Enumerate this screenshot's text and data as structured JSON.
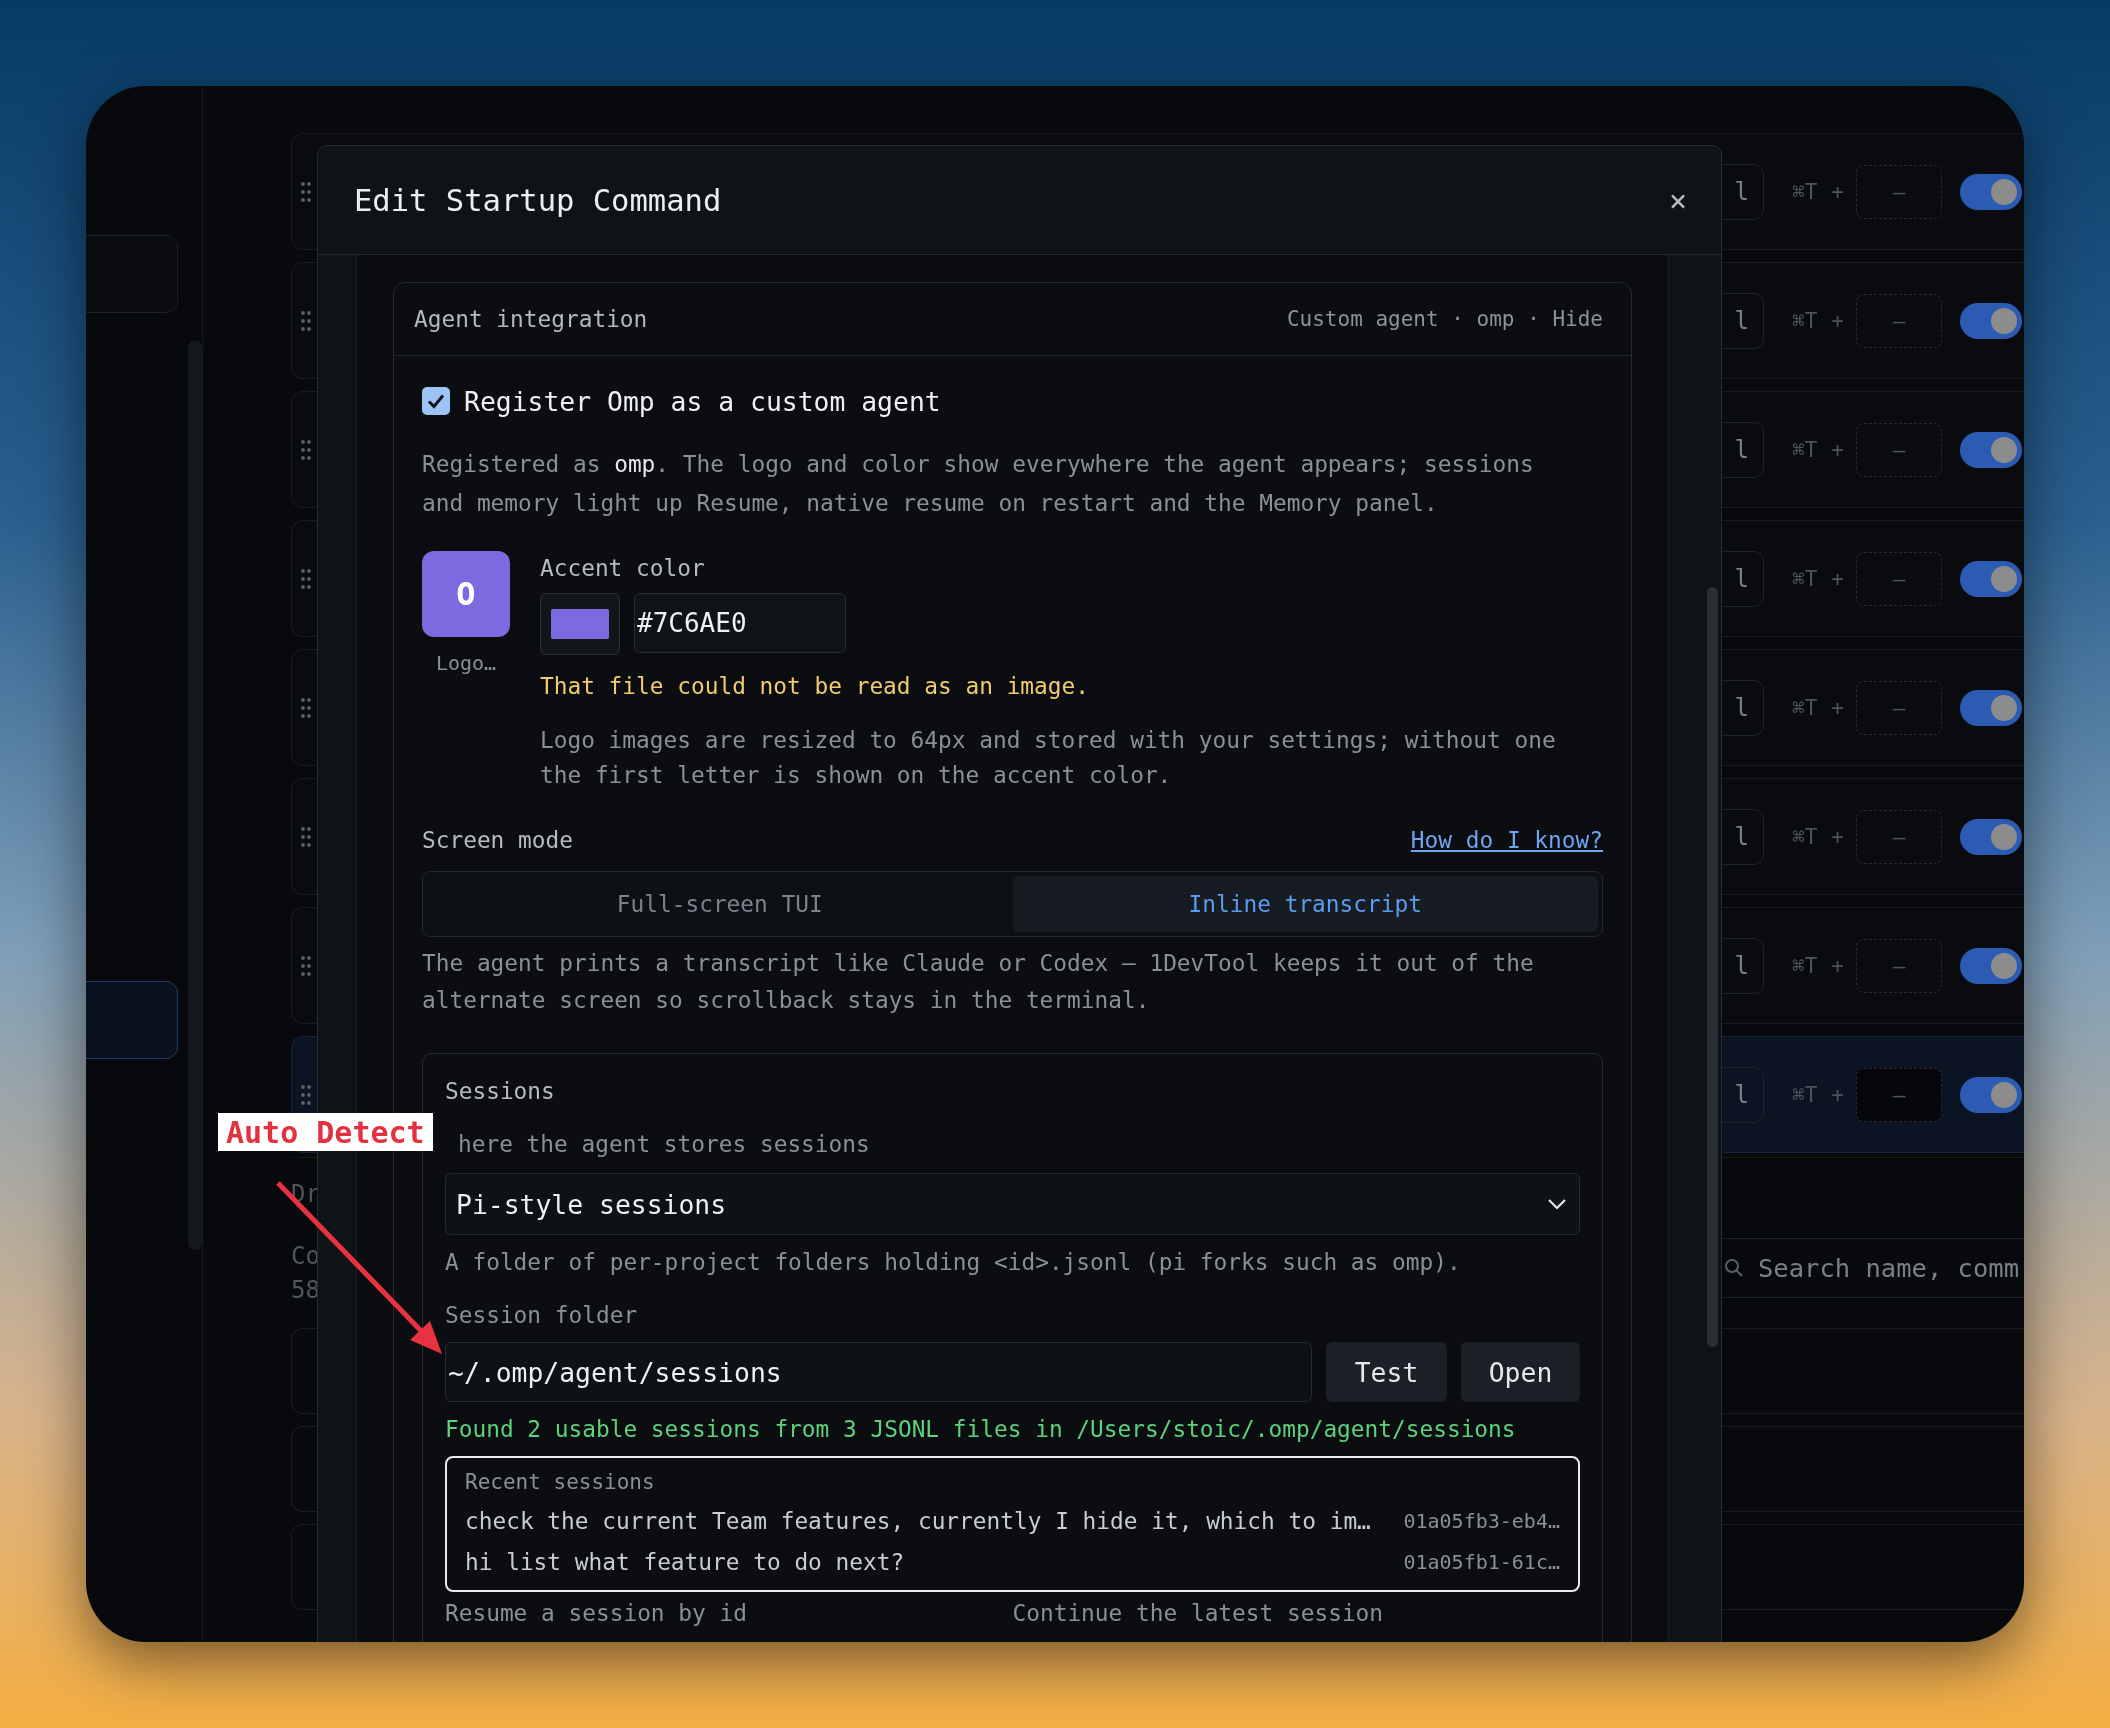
{
  "sidebar": {
    "items": [
      {
        "selected": false
      },
      {
        "selected": true
      }
    ]
  },
  "rows": [
    {
      "label": "l",
      "shortcut": "⌘T",
      "plus": "+",
      "key": "—",
      "on": true,
      "selected": false
    },
    {
      "label": "l",
      "shortcut": "⌘T",
      "plus": "+",
      "key": "—",
      "on": true,
      "selected": false
    },
    {
      "label": "l",
      "shortcut": "⌘T",
      "plus": "+",
      "key": "—",
      "on": true,
      "selected": false
    },
    {
      "label": "l",
      "shortcut": "⌘T",
      "plus": "+",
      "key": "—",
      "on": true,
      "selected": false
    },
    {
      "label": "l",
      "shortcut": "⌘T",
      "plus": "+",
      "key": "—",
      "on": true,
      "selected": false
    },
    {
      "label": "l",
      "shortcut": "⌘T",
      "plus": "+",
      "key": "—",
      "on": true,
      "selected": false
    },
    {
      "label": "l",
      "shortcut": "⌘T",
      "plus": "+",
      "key": "—",
      "on": true,
      "selected": false
    },
    {
      "label": "l",
      "shortcut": "⌘T",
      "plus": "+",
      "key": "—",
      "on": true,
      "selected": true
    }
  ],
  "lower_texts": [
    "Dr",
    "Co",
    "58"
  ],
  "search": {
    "placeholder": "Search name, comm"
  },
  "dialog": {
    "title": "Edit Startup Command",
    "close": "×",
    "agent": {
      "title": "Agent integration",
      "summary": "Custom agent · omp · Hide",
      "register": {
        "label": "Register Omp as a custom agent",
        "checked": true
      },
      "description": "Registered as **omp**. The logo and color show everywhere the agent appears; sessions and memory light up Resume, native resume on restart and the Memory panel.",
      "logo": {
        "letter": "O",
        "caption": "Logo…"
      },
      "accent": {
        "label": "Accent color",
        "color": "#7c6ae0",
        "value": "#7C6AE0"
      },
      "warning": "That file could not be read as an image.",
      "help": "Logo images are resized to 64px and stored with your settings; without one the first letter is shown on the accent color.",
      "screen_mode": {
        "label": "Screen mode",
        "link": "How do I know?",
        "options": [
          {
            "label": "Full-screen TUI",
            "selected": false
          },
          {
            "label": "Inline transcript",
            "selected": true
          }
        ],
        "description": "The agent prints a transcript like Claude or Codex — 1DevTool keeps it out of the alternate screen so scrollback stays in the terminal."
      },
      "sessions": {
        "title": "Sessions",
        "store_label": "here the agent stores sessions",
        "store_value": "Pi-style sessions",
        "store_hint": "A folder of per-project folders holding <id>.jsonl (pi forks such as omp).",
        "folder_label": "Session folder",
        "folder_value": "~/.omp/agent/sessions",
        "buttons": [
          "Test",
          "Open"
        ],
        "status": "Found 2 usable sessions from 3 JSONL files in /Users/stoic/.omp/agent/sessions",
        "recent": {
          "title": "Recent sessions",
          "items": [
            {
              "text": "check the current Team features, currently I hide it, which to im…",
              "id": "01a05fb3-eb4…"
            },
            {
              "text": "hi list what feature to do next?",
              "id": "01a05fb1-61c…"
            }
          ]
        },
        "footer_labels": [
          "Resume a session by id",
          "Continue the latest session"
        ]
      }
    }
  },
  "annotation": {
    "label": "Auto Detect"
  }
}
